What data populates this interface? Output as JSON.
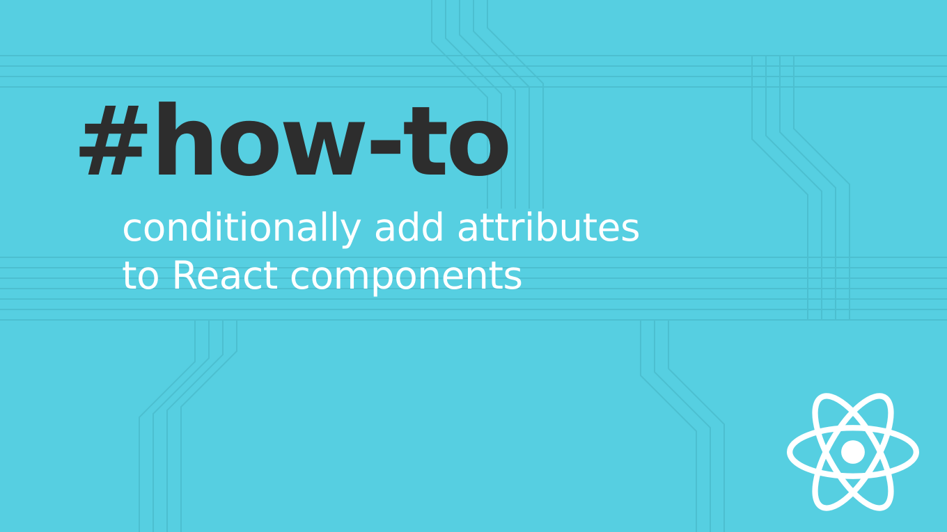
{
  "banner": {
    "tag": "#how-to",
    "subtitle_line1": "conditionally add attributes",
    "subtitle_line2": "to React components",
    "logo_name": "react-logo-icon"
  },
  "colors": {
    "background": "#56cfe1",
    "tag_text": "#2d2d2d",
    "subtitle_text": "#ffffff",
    "circuit_line": "#4cbfd0"
  }
}
